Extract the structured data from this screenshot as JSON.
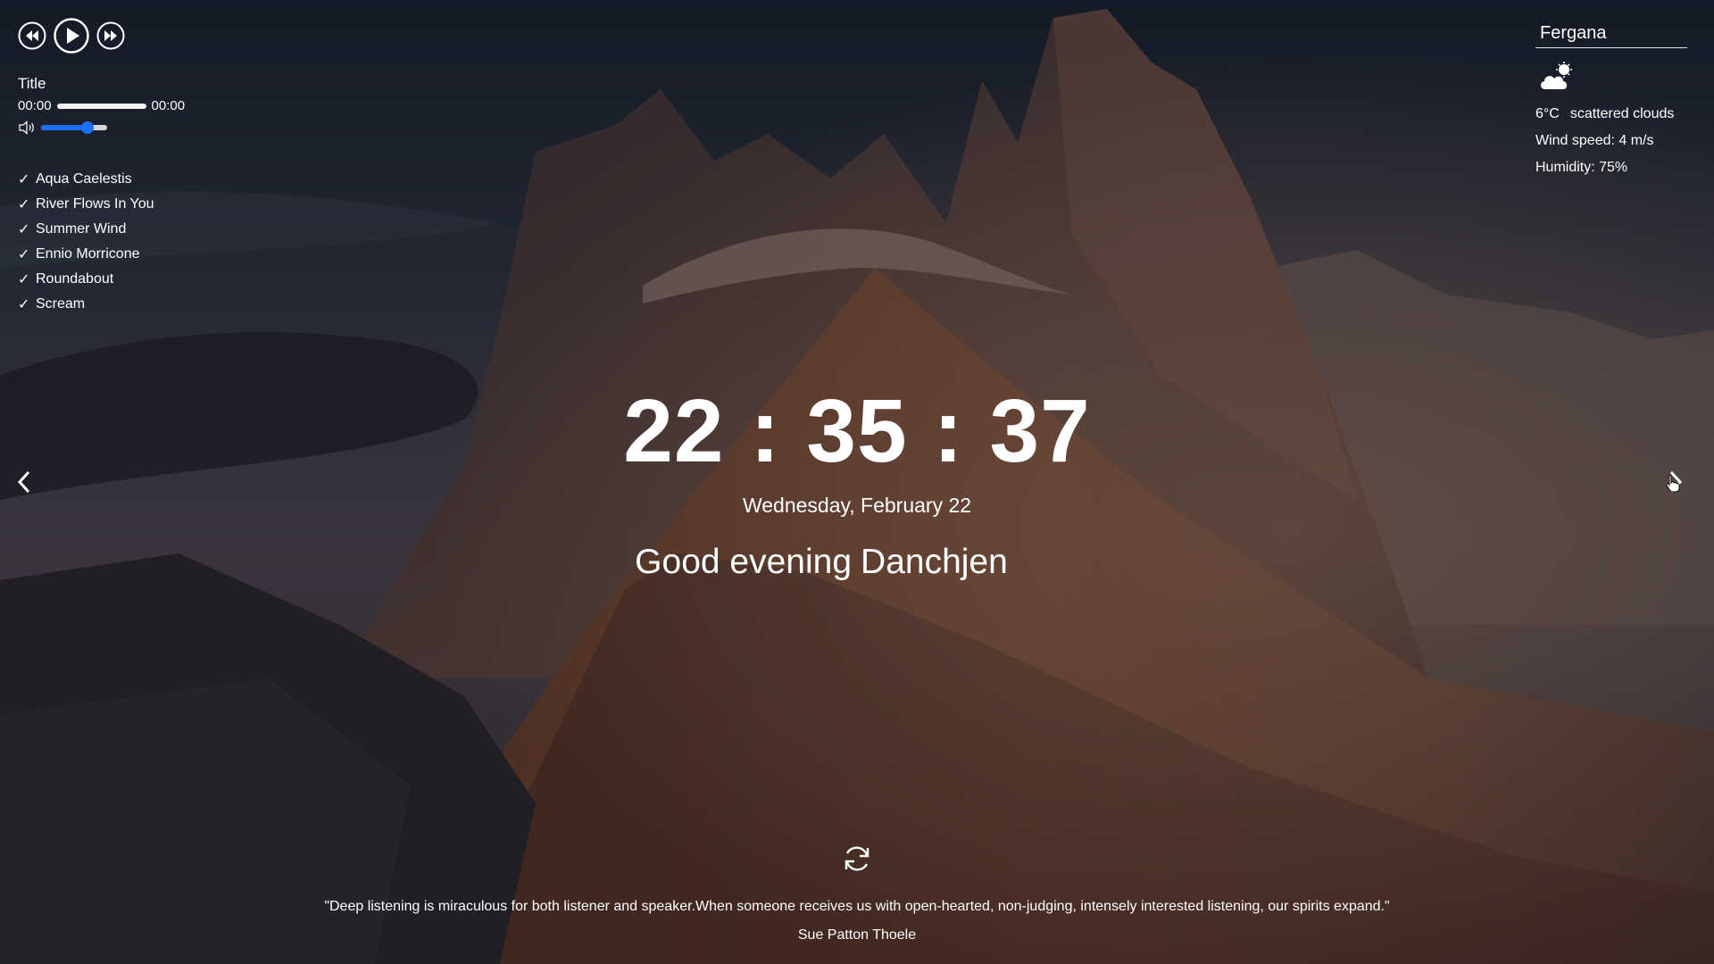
{
  "player": {
    "track_title": "Title",
    "current_time": "00:00",
    "duration": "00:00",
    "progress": 0,
    "volume": 0.7,
    "playlist": [
      {
        "label": "Aqua Caelestis"
      },
      {
        "label": "River Flows In You"
      },
      {
        "label": "Summer Wind"
      },
      {
        "label": "Ennio Morricone"
      },
      {
        "label": "Roundabout"
      },
      {
        "label": "Scream"
      }
    ],
    "check_mark": "✓"
  },
  "weather": {
    "city": "Fergana",
    "icon": "scattered-clouds-icon",
    "temperature": "6°C",
    "description": "scattered clouds",
    "wind": "Wind speed: 4 m/s",
    "humidity": "Humidity: 75%"
  },
  "clock": {
    "time": "22 : 35 : 37",
    "date": "Wednesday, February 22"
  },
  "greeting": {
    "text": "Good evening",
    "name": "Danchjen"
  },
  "quote": {
    "text": "\"Deep listening is miraculous for both listener and speaker.When someone receives us with open-hearted, non-judging, intensely interested listening, our spirits expand.\"",
    "author": "Sue Patton Thoele"
  },
  "colors": {
    "accent": "#1e6ef7",
    "text": "#ffffff"
  }
}
